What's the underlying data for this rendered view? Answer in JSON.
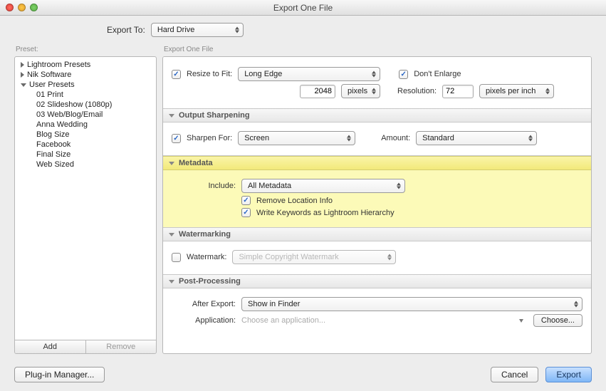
{
  "window": {
    "title": "Export One File"
  },
  "exportTo": {
    "label": "Export To:",
    "value": "Hard Drive"
  },
  "presetLabel": "Preset:",
  "rightLabel": "Export One File",
  "presets": {
    "groups": [
      {
        "label": "Lightroom Presets",
        "open": false
      },
      {
        "label": "Nik Software",
        "open": false
      },
      {
        "label": "User Presets",
        "open": true
      }
    ],
    "userItems": [
      "01 Print",
      "02 Slideshow (1080p)",
      "03 Web/Blog/Email",
      "Anna Wedding",
      "Blog Size",
      "Facebook",
      "Final Size",
      "Web Sized"
    ],
    "addLabel": "Add",
    "removeLabel": "Remove"
  },
  "sizing": {
    "resizeLabel": "Resize to Fit:",
    "resizeValue": "Long Edge",
    "dontEnlargeLabel": "Don't Enlarge",
    "dimValue": "2048",
    "dimUnit": "pixels",
    "resolutionLabel": "Resolution:",
    "resolutionValue": "72",
    "resolutionUnit": "pixels per inch"
  },
  "sharpen": {
    "title": "Output Sharpening",
    "forLabel": "Sharpen For:",
    "forValue": "Screen",
    "amountLabel": "Amount:",
    "amountValue": "Standard"
  },
  "metadata": {
    "title": "Metadata",
    "includeLabel": "Include:",
    "includeValue": "All Metadata",
    "removeLoc": "Remove Location Info",
    "writeKw": "Write Keywords as Lightroom Hierarchy"
  },
  "watermark": {
    "title": "Watermarking",
    "label": "Watermark:",
    "value": "Simple Copyright Watermark"
  },
  "post": {
    "title": "Post-Processing",
    "afterLabel": "After Export:",
    "afterValue": "Show in Finder",
    "appLabel": "Application:",
    "appPlaceholder": "Choose an application...",
    "chooseLabel": "Choose..."
  },
  "buttons": {
    "plugin": "Plug-in Manager...",
    "cancel": "Cancel",
    "export": "Export"
  }
}
